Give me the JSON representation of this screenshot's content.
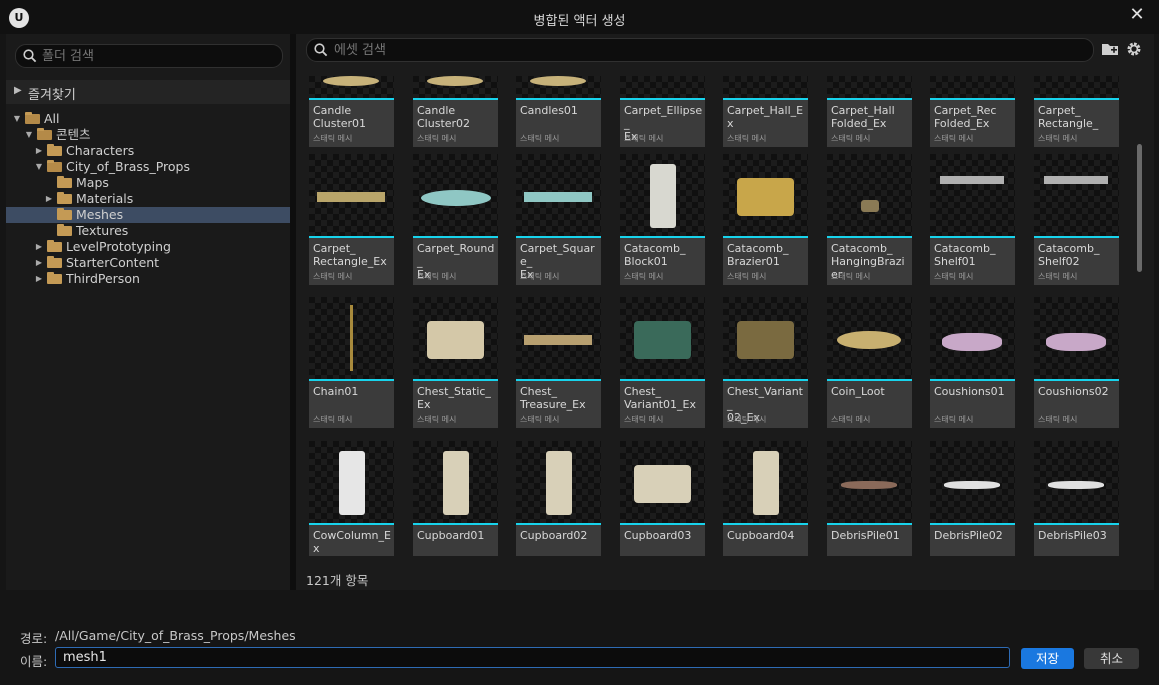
{
  "window": {
    "title": "병합된 액터 생성"
  },
  "left": {
    "search_placeholder": "폴더 검색",
    "favorites": "즐겨찾기",
    "tree": [
      {
        "label": "All",
        "level": 0,
        "expanded": true,
        "selected": false
      },
      {
        "label": "콘텐츠",
        "level": 1,
        "expanded": true,
        "selected": false
      },
      {
        "label": "Characters",
        "level": 2,
        "expanded": false,
        "selected": false
      },
      {
        "label": "City_of_Brass_Props",
        "level": 2,
        "expanded": true,
        "selected": false
      },
      {
        "label": "Maps",
        "level": 3,
        "expanded": null,
        "selected": false
      },
      {
        "label": "Materials",
        "level": 3,
        "expanded": false,
        "selected": false
      },
      {
        "label": "Meshes",
        "level": 3,
        "expanded": null,
        "selected": true
      },
      {
        "label": "Textures",
        "level": 3,
        "expanded": null,
        "selected": false
      },
      {
        "label": "LevelPrototyping",
        "level": 2,
        "expanded": false,
        "selected": false
      },
      {
        "label": "StarterContent",
        "level": 2,
        "expanded": false,
        "selected": false
      },
      {
        "label": "ThirdPerson",
        "level": 2,
        "expanded": false,
        "selected": false
      }
    ]
  },
  "right": {
    "search_placeholder": "에셋 검색",
    "asset_type": "스태틱 메시",
    "count_text": "121개 항목",
    "assets": [
      [
        "Candle\nCluster01",
        "Candle\nCluster02",
        "Candles01",
        "Carpet_Ellipse_\nEx",
        "Carpet_Hall_Ex",
        "Carpet_Hall\nFolded_Ex",
        "Carpet_Rec\nFolded_Ex",
        "Carpet_\nRectangle_"
      ],
      [
        "Carpet_\nRectangle_Ex",
        "Carpet_Round_\nEx",
        "Carpet_Square_\nEx",
        "Catacomb_\nBlock01",
        "Catacomb_\nBrazier01",
        "Catacomb_\nHangingBrazier",
        "Catacomb_\nShelf01",
        "Catacomb_\nShelf02"
      ],
      [
        "Chain01",
        "Chest_Static_\nEx",
        "Chest_\nTreasure_Ex",
        "Chest_\nVariant01_Ex",
        "Chest_Variant_\n02_Ex",
        "Coin_Loot",
        "Coushions01",
        "Coushions02"
      ],
      [
        "CowColumn_Ex",
        "Cupboard01",
        "Cupboard02",
        "Cupboard03",
        "Cupboard04",
        "DebrisPile01",
        "DebrisPile02",
        "DebrisPile03"
      ]
    ]
  },
  "footer": {
    "path_label": "경로:",
    "path_value": "/All/Game/City_of_Brass_Props/Meshes",
    "name_label": "이름:",
    "name_value": "mesh1",
    "save_label": "저장",
    "cancel_label": "취소"
  },
  "icons": [
    "unreal-logo-icon",
    "close-icon",
    "search-icon",
    "add-folder-icon",
    "settings-icon",
    "folder-icon"
  ],
  "colors": {
    "accent": "#1a78e0",
    "selection": "#3d4c63",
    "thumb_bar": "#18d3ec"
  }
}
